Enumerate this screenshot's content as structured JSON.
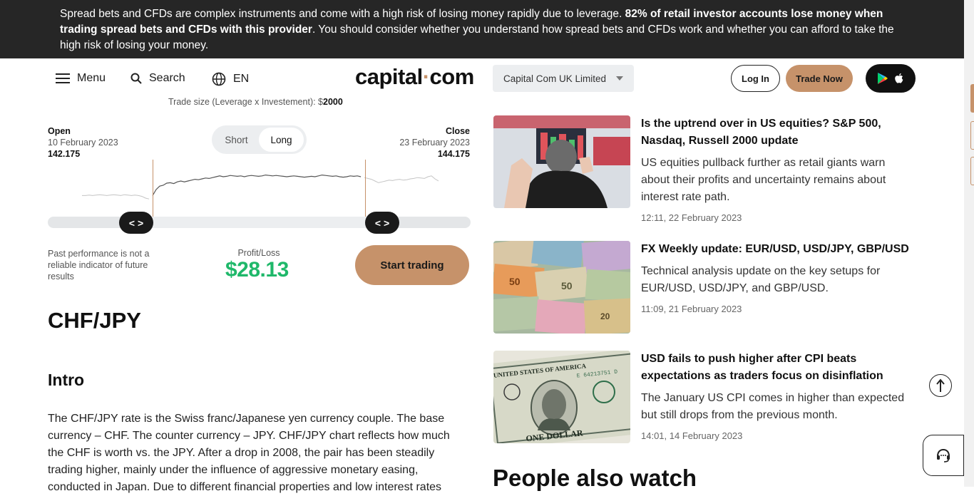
{
  "risk_banner": {
    "text1": "Spread bets and CFDs are complex instruments and come with a high risk of losing money rapidly due to leverage. ",
    "bold": "82% of retail investor accounts lose money when trading spread bets and CFDs with this provider",
    "text2": ". You should consider whether you understand how spread bets and CFDs work and whether you can afford to take the high risk of losing your money."
  },
  "header": {
    "menu_label": "Menu",
    "search_label": "Search",
    "language": "EN",
    "logo_left": "capital",
    "logo_dot": "·",
    "logo_right": "com",
    "entity": "Capital Com UK Limited",
    "login": "Log In",
    "trade_now": "Trade Now"
  },
  "calculator": {
    "trade_size_label": "Trade size (Leverage x Investement): $",
    "trade_size_value": "2000",
    "open_label": "Open",
    "open_date": "10 February 2023",
    "open_value": "142.175",
    "close_label": "Close",
    "close_date": "23 February 2023",
    "close_value": "144.175",
    "short_label": "Short",
    "long_label": "Long",
    "selected_side": "Long",
    "handle_glyph": "< >",
    "disclaimer": "Past performance is not a reliable indicator of future results",
    "pl_label": "Profit/Loss",
    "pl_value": "$28.13",
    "cta": "Start trading",
    "sparkline": [
      0.26,
      0.26,
      0.27,
      0.26,
      0.27,
      0.28,
      0.27,
      0.26,
      0.27,
      0.28,
      0.27,
      0.26,
      0.28,
      0.27,
      0.26,
      0.27,
      0.26,
      0.24,
      0.2,
      0.18,
      0.26,
      0.4,
      0.48,
      0.5,
      0.55,
      0.56,
      0.54,
      0.58,
      0.6,
      0.58,
      0.6,
      0.62,
      0.64,
      0.63,
      0.65,
      0.67,
      0.66,
      0.68,
      0.7,
      0.72,
      0.7,
      0.71,
      0.73,
      0.72,
      0.71,
      0.72,
      0.7,
      0.72,
      0.73,
      0.72,
      0.71,
      0.72,
      0.74,
      0.73,
      0.72,
      0.73,
      0.72,
      0.71,
      0.7,
      0.71,
      0.72,
      0.71,
      0.7,
      0.69,
      0.7,
      0.71,
      0.7,
      0.72,
      0.74,
      0.73,
      0.72,
      0.71,
      0.72,
      0.7,
      0.69,
      0.7,
      0.72,
      0.71,
      0.72,
      0.7,
      0.68,
      0.66,
      0.64,
      0.6,
      0.56,
      0.58,
      0.6,
      0.62,
      0.61,
      0.63,
      0.64,
      0.62,
      0.63,
      0.65,
      0.66,
      0.68,
      0.67,
      0.66,
      0.7,
      0.72,
      0.65,
      0.6
    ],
    "sparkline_active_range": [
      0.19,
      0.79
    ]
  },
  "main": {
    "pair_title": "CHF/JPY",
    "section_title": "Intro",
    "intro_text": "The CHF/JPY rate is the Swiss franc/Japanese yen currency couple. The base currency – CHF. The counter currency – JPY. CHF/JPY chart reflects how much the CHF is worth vs. the JPY. After a drop in 2008, the pair has been steadily trading higher, mainly under the influence of aggressive monetary easing, conducted in Japan. Due to different financial properties and low interest rates"
  },
  "news": [
    {
      "title": "Is the uptrend over in US equities? S&P 500, Nasdaq, Russell 2000 update",
      "desc": "US equities pullback further as retail giants warn about their profits and uncertainty remains about interest rate path.",
      "time": "12:11, 22 February 2023"
    },
    {
      "title": "FX Weekly update: EUR/USD, USD/JPY, GBP/USD",
      "desc": "Technical analysis update on the key setups for EUR/USD, USD/JPY, and GBP/USD.",
      "time": "11:09, 21 February 2023"
    },
    {
      "title": "USD fails to push higher after CPI beats expectations as traders focus on disinflation",
      "desc": "The January US CPI comes in higher than expected but still drops from the previous month.",
      "time": "14:01, 14 February 2023"
    }
  ],
  "people_also_watch": "People also watch",
  "colors": {
    "accent": "#c6926a",
    "profit": "#1fb86a",
    "banner_bg": "#262626"
  }
}
